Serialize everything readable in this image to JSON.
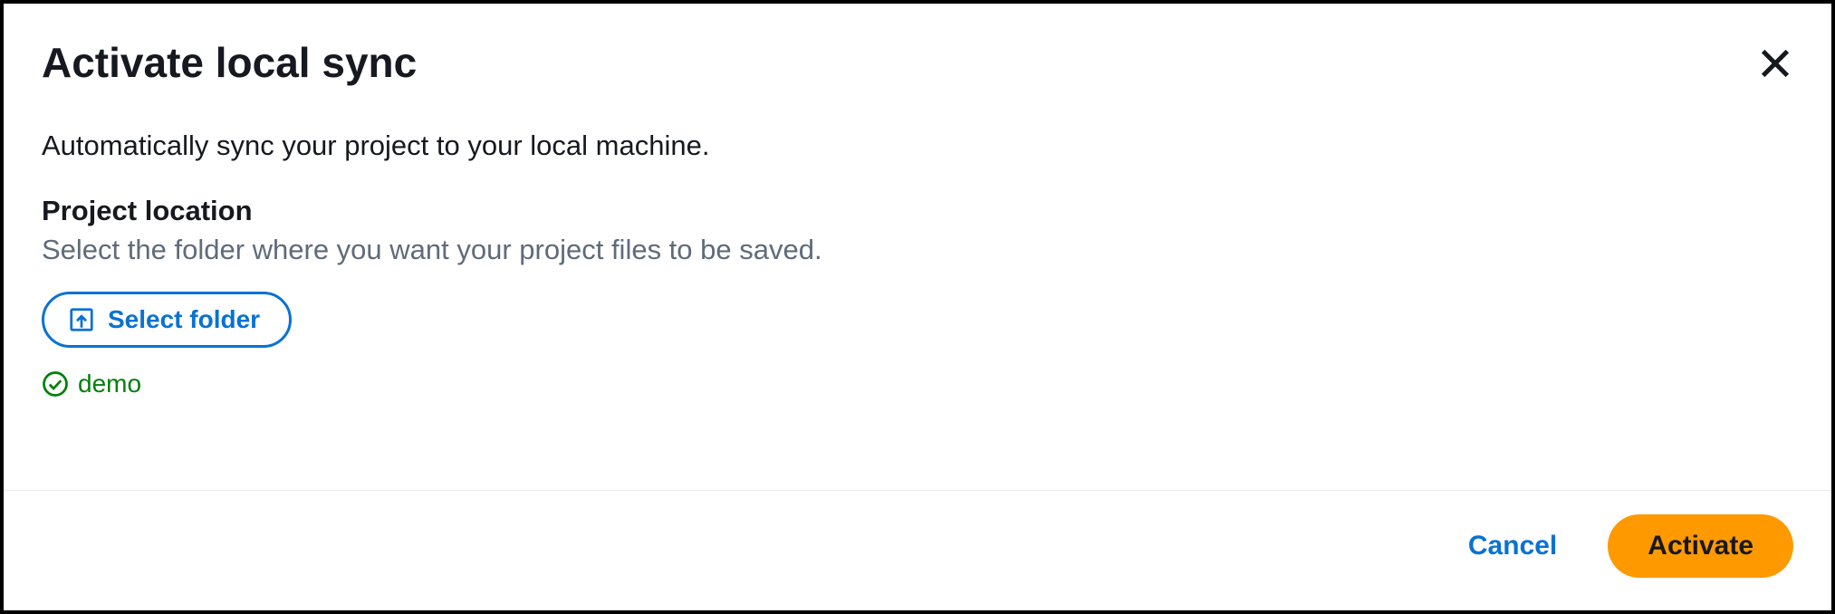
{
  "dialog": {
    "title": "Activate local sync",
    "description": "Automatically sync your project to your local machine.",
    "section": {
      "label": "Project location",
      "hint": "Select the folder where you want your project files to be saved.",
      "select_folder_label": "Select folder",
      "selected_folder": "demo"
    },
    "footer": {
      "cancel_label": "Cancel",
      "activate_label": "Activate"
    }
  }
}
